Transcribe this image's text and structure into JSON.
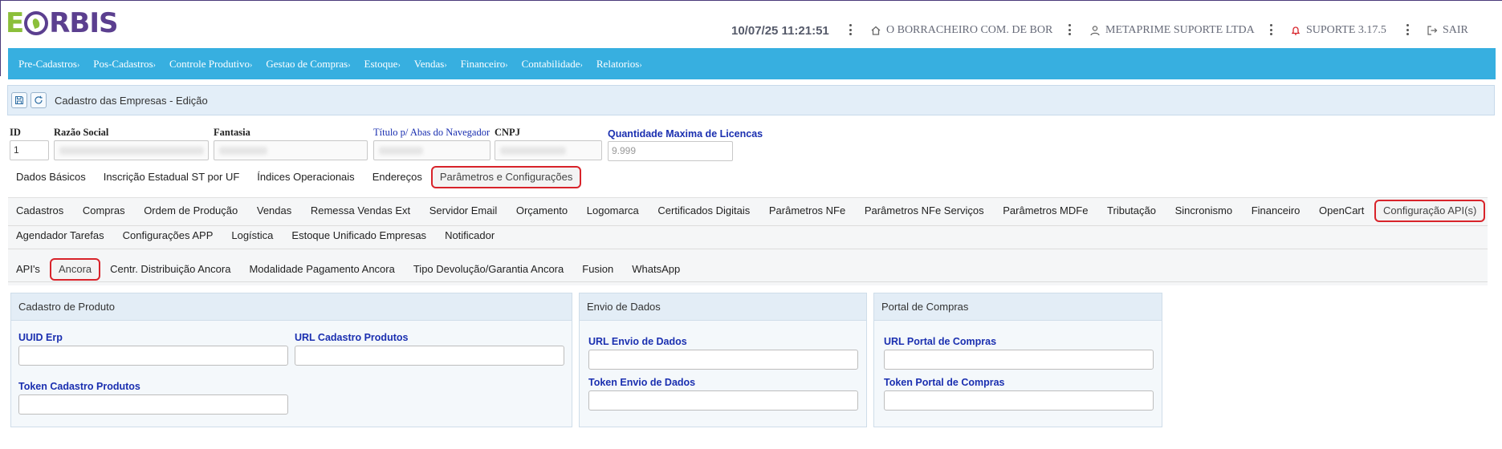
{
  "header": {
    "logo": "EORBIS",
    "datetime": "10/07/25 11:21:51",
    "store": "O BORRACHEIRO COM. DE BOR",
    "user": "METAPRIME SUPORTE LTDA",
    "version": "SUPORTE 3.17.5",
    "logout": "SAIR"
  },
  "menu": [
    "Pre-Cadastros",
    "Pos-Cadastros",
    "Controle Produtivo",
    "Gestao de Compras",
    "Estoque",
    "Vendas",
    "Financeiro",
    "Contabilidade",
    "Relatorios"
  ],
  "menu_chevron": "›",
  "page": {
    "title": "Cadastro das Empresas - Edição"
  },
  "form": {
    "id_label": "ID",
    "id_value": "1",
    "razao_label": "Razão Social",
    "fantasia_label": "Fantasia",
    "titulo_label": "Título p/ Abas do Navegador",
    "cnpj_label": "CNPJ",
    "licencas_label": "Quantidade Maxima de Licencas",
    "licencas_placeholder": "9.999"
  },
  "main_tabs": [
    "Dados Básicos",
    "Inscrição Estadual ST por UF",
    "Índices Operacionais",
    "Endereços",
    "Parâmetros e Configurações"
  ],
  "config_tabs_row1": [
    "Cadastros",
    "Compras",
    "Ordem de Produção",
    "Vendas",
    "Remessa Vendas Ext",
    "Servidor Email",
    "Orçamento",
    "Logomarca",
    "Certificados Digitais",
    "Parâmetros NFe",
    "Parâmetros NFe Serviços",
    "Parâmetros MDFe",
    "Tributação",
    "Sincronismo",
    "Financeiro",
    "OpenCart",
    "Configuração API(s)"
  ],
  "config_tabs_row2": [
    "Agendador Tarefas",
    "Configurações APP",
    "Logística",
    "Estoque Unificado Empresas",
    "Notificador"
  ],
  "api_tabs": [
    "API's",
    "Ancora",
    "Centr. Distribuição Ancora",
    "Modalidade Pagamento Ancora",
    "Tipo Devolução/Garantia Ancora",
    "Fusion",
    "WhatsApp"
  ],
  "panels": {
    "produto": {
      "title": "Cadastro de Produto",
      "uuid_label": "UUID Erp",
      "url_label": "URL Cadastro Produtos",
      "token_label": "Token Cadastro Produtos"
    },
    "envio": {
      "title": "Envio de Dados",
      "url_label": "URL Envio de Dados",
      "token_label": "Token Envio de Dados"
    },
    "portal": {
      "title": "Portal de Compras",
      "url_label": "URL Portal de Compras",
      "token_label": "Token Portal de Compras"
    }
  },
  "colors": {
    "menu_bg": "#37afe0",
    "label_blue": "#1a2fb0",
    "selected_outline": "#d8232a",
    "logo_green": "#8bbf3a",
    "logo_purple": "#5b3f8f"
  }
}
